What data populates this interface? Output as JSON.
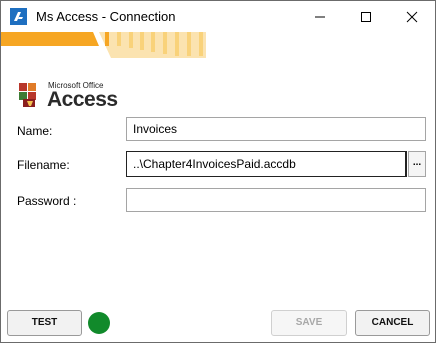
{
  "window": {
    "title": "Ms Access - Connection",
    "app_icon": "app-icon"
  },
  "titlebar_controls": {
    "minimize_icon": "minimize-icon",
    "maximize_icon": "maximize-icon",
    "close_icon": "close-icon"
  },
  "logo": {
    "small_text": "Microsoft Office",
    "product": "Access"
  },
  "form": {
    "name_label": "Name:",
    "name_value": "Invoices",
    "filename_label": "Filename:",
    "filename_value": "..\\Chapter4InvoicesPaid.accdb",
    "browse_label": "...",
    "password_label": "Password :",
    "password_value": ""
  },
  "buttons": {
    "test": "TEST",
    "save": "SAVE",
    "cancel": "CANCEL"
  },
  "status": {
    "connection_ok": true
  },
  "colors": {
    "accent_orange": "#f6a623",
    "banner_yellow": "#f9d27a",
    "status_green": "#118a2b",
    "icon_blue": "#1e6fc0"
  }
}
